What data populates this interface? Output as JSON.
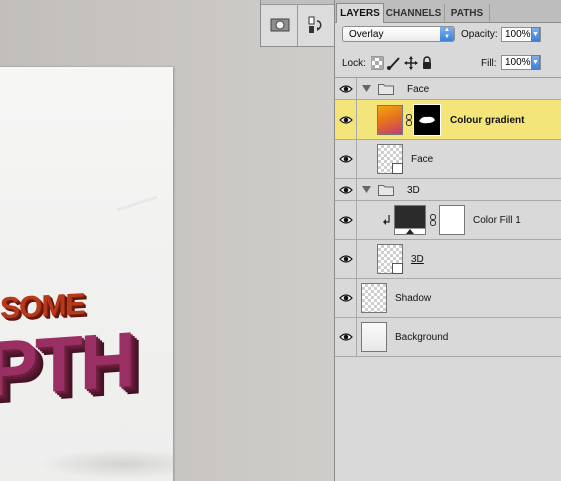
{
  "canvas": {
    "art_line1": "SOME",
    "art_line2": "PTH"
  },
  "panel": {
    "tabs": [
      "LAYERS",
      "CHANNELS",
      "PATHS"
    ],
    "blend_mode": "Overlay",
    "opacity_label": "Opacity:",
    "opacity_value": "100%",
    "lock_label": "Lock:",
    "fill_label": "Fill:",
    "fill_value": "100%",
    "layers": [
      {
        "name": "Face",
        "kind": "group",
        "expanded": true,
        "selected": false
      },
      {
        "name": "Colour gradient",
        "kind": "layer-with-mask",
        "selected": true
      },
      {
        "name": "Face",
        "kind": "smart-object",
        "selected": false
      },
      {
        "name": "3D",
        "kind": "group",
        "expanded": true,
        "selected": false
      },
      {
        "name": "Color Fill 1",
        "kind": "fill-with-mask",
        "clipped": true,
        "selected": false
      },
      {
        "name": "3D",
        "kind": "smart-object",
        "selected": false
      },
      {
        "name": "Shadow",
        "kind": "layer",
        "selected": false
      },
      {
        "name": "Background",
        "kind": "layer",
        "selected": false
      }
    ]
  },
  "colors": {
    "selected_row": "#f4e57a",
    "panel_bg": "#d9d9d9",
    "gradient_thumb": [
      "#f2a014",
      "#c03a7a"
    ]
  }
}
